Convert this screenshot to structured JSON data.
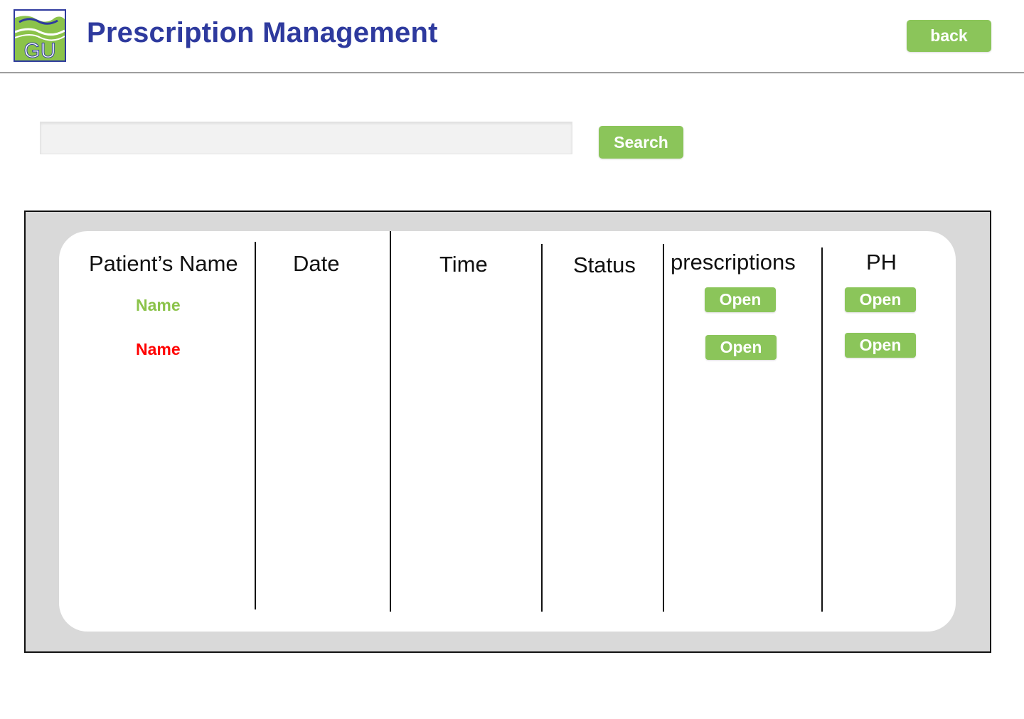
{
  "header": {
    "title": "Prescription Management",
    "logo_text": "GU",
    "back_label": "back"
  },
  "search": {
    "value": "",
    "placeholder": "",
    "button_label": "Search"
  },
  "table": {
    "columns": [
      "Patient’s Name",
      "Date",
      "Time",
      "Status",
      "prescriptions",
      "PH"
    ],
    "rows": [
      {
        "name": "Name",
        "name_color": "#8bc34a",
        "prescriptions_label": "Open",
        "ph_label": "Open"
      },
      {
        "name": "Name",
        "name_color": "#ff0000",
        "prescriptions_label": "Open",
        "ph_label": "Open"
      }
    ]
  },
  "colors": {
    "brand_blue": "#2e3a9e",
    "accent_green": "#8bc55a",
    "frame_gray": "#d9d9d9"
  }
}
